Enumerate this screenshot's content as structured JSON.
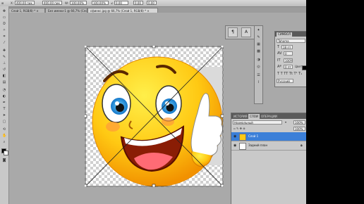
{
  "options_bar": {
    "w_value": "400,00 пик",
    "h_value": "400,00 пик",
    "x_scale": "100,00%",
    "y_scale": "100,00%",
    "angle": "0,00",
    "skew_h": "0,00",
    "skew_v": "0,00"
  },
  "tabs": [
    {
      "label": "Слой 1, RGB/8) * ×",
      "active": false
    },
    {
      "label": "Без имени-1 @ 66,7% (Слой 1, RGB/8) * ×",
      "active": false
    },
    {
      "label": "сфинкс.jpg @ 66,7% (Слой 1, RGB/8) * ×",
      "active": true
    }
  ],
  "character_panel": {
    "tab": "СИМВОЛ",
    "font_family": "Tahoma",
    "font_size": "18 пт",
    "tracking": "0",
    "vertical_scale": "100%",
    "baseline": "0 пт",
    "color_label": "Цвет:",
    "language": "Русский"
  },
  "layers_panel": {
    "tabs": [
      "ИСТОРИЯ",
      "СЛОИ",
      "ОПЕРАЦИИ"
    ],
    "active_tab": "СЛОИ",
    "blend_mode": "Нормальный",
    "opacity": "100%",
    "fill": "100%",
    "layers": [
      {
        "name": "Слой 1",
        "selected": true
      },
      {
        "name": "Задний план",
        "selected": false
      }
    ]
  },
  "colors": {
    "accent_selection": "#3b7fd8",
    "workspace": "#a9a9a9",
    "panel_bg": "#c9c9c9"
  }
}
